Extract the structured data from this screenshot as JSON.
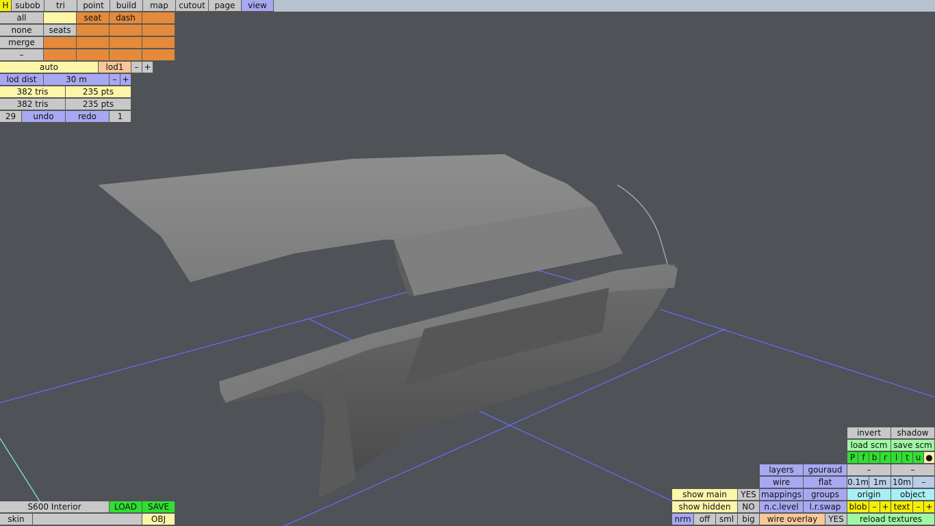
{
  "menu": {
    "h": "H",
    "tabs": [
      "subob",
      "tri",
      "point",
      "build",
      "map",
      "cutout",
      "page",
      "view"
    ],
    "active_tab": "view"
  },
  "selection": {
    "all": "all",
    "none": "none",
    "merge": "merge",
    "minus": "–",
    "seat": "seat",
    "dash": "dash",
    "seats": "seats"
  },
  "lod": {
    "auto": "auto",
    "level": "lod1",
    "minus": "–",
    "plus": "+",
    "dist_label": "lod dist",
    "dist_value": "30 m",
    "dist_minus": "–",
    "dist_plus": "+"
  },
  "stats": {
    "tris_1": "382 tris",
    "pts_1": "235 pts",
    "tris_2": "382 tris",
    "pts_2": "235 pts"
  },
  "history": {
    "undo_count": "29",
    "undo": "undo",
    "redo": "redo",
    "redo_count": "1"
  },
  "file": {
    "name": "S600 Interior",
    "load": "LOAD",
    "save": "SAVE",
    "skin": "skin",
    "skin_value": "",
    "obj": "OBJ"
  },
  "view_panel": {
    "invert": "invert",
    "shadow": "shadow",
    "load_scm": "load scm",
    "save_scm": "save scm",
    "views": [
      "P",
      "f",
      "b",
      "r",
      "l",
      "t",
      "u",
      "●"
    ],
    "layers": "layers",
    "gouraud": "gouraud",
    "dash_1": "–",
    "dash_2": "–",
    "wire": "wire",
    "flat": "flat",
    "grid_01": "0.1m",
    "grid_1": "1m",
    "grid_10": "10m",
    "grid_minus": "–",
    "show_main": "show main",
    "show_main_val": "YES",
    "mappings": "mappings",
    "groups": "groups",
    "origin": "origin",
    "object": "object",
    "show_hidden": "show hidden",
    "show_hidden_val": "NO",
    "nc_level": "n.c.level",
    "lr_swap": "l.r.swap",
    "blob": "blob",
    "blob_minus": "–",
    "blob_plus": "+",
    "text": "text",
    "text_minus": "–",
    "text_plus": "+",
    "nrm": "nrm",
    "off": "off",
    "sml": "sml",
    "big": "big",
    "wire_overlay": "wire overlay",
    "wire_overlay_val": "YES",
    "reload_textures": "reload textures"
  },
  "colors": {
    "background": "#4f5257",
    "grid_lines": "#6a6af0",
    "model": "#8a8a8a"
  }
}
